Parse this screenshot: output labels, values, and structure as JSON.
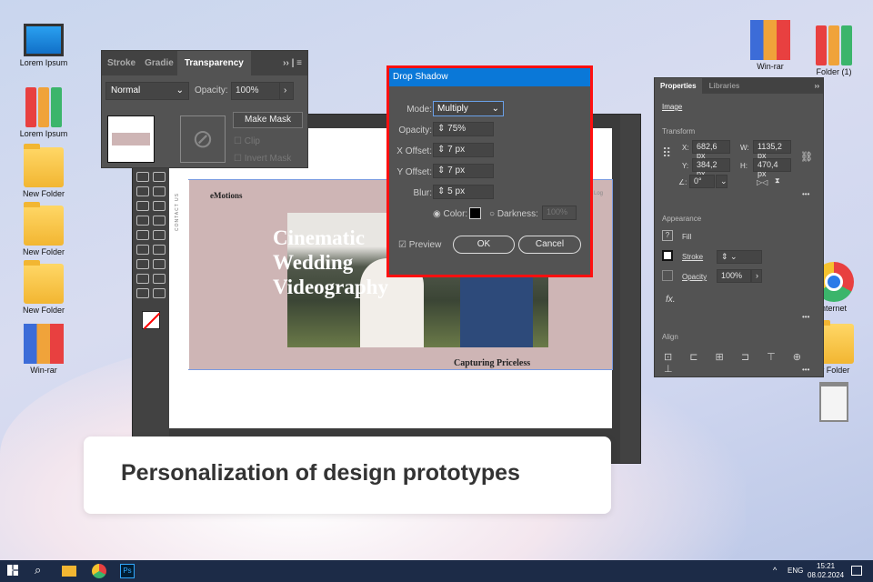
{
  "desktop": {
    "left_icons": [
      {
        "label": "Lorem Ipsum",
        "icon": "monitor-icon"
      },
      {
        "label": "Lorem Ipsum",
        "icon": "binders-icon"
      },
      {
        "label": "New Folder",
        "icon": "folder-icon"
      },
      {
        "label": "New Folder",
        "icon": "folder-icon"
      },
      {
        "label": "New Folder",
        "icon": "folder-icon"
      },
      {
        "label": "Win-rar",
        "icon": "winrar-icon"
      }
    ],
    "right_icons": [
      {
        "label": "Win-rar",
        "icon": "winrar-icon"
      },
      {
        "label": "Folder (1)",
        "icon": "binders-icon"
      },
      {
        "label": "nternet",
        "icon": "chrome-icon"
      },
      {
        "label": "w Folder",
        "icon": "folder-icon"
      },
      {
        "label": "",
        "icon": "recycle-bin-icon"
      }
    ]
  },
  "transparency": {
    "tabs": [
      "Stroke",
      "Gradie",
      "Transparency"
    ],
    "blend_mode": "Normal",
    "opacity_label": "Opacity:",
    "opacity": "100%",
    "make_mask": "Make Mask",
    "clip": "Clip",
    "invert_mask": "Invert Mask"
  },
  "drop_shadow": {
    "title": "Drop Shadow",
    "mode_label": "Mode:",
    "mode": "Multiply",
    "opacity_label": "Opacity:",
    "opacity": "75%",
    "x_label": "X Offset:",
    "x": "7 px",
    "y_label": "Y Offset:",
    "y": "7 px",
    "blur_label": "Blur:",
    "blur": "5 px",
    "color_label": "Color:",
    "darkness_label": "Darkness:",
    "darkness": "100%",
    "preview": "Preview",
    "ok": "OK",
    "cancel": "Cancel",
    "color": "#000000"
  },
  "artboard": {
    "brand": "eMotions",
    "side_text": "CONTACT US",
    "headline": [
      "Cinematic",
      "Wedding",
      "Videography"
    ],
    "subhead": "Capturing Priceless",
    "login": "Log"
  },
  "properties": {
    "tabs": [
      "Properties",
      "Libraries"
    ],
    "object": "Image",
    "transform": "Transform",
    "x_label": "X:",
    "x": "682,6 px",
    "y_label": "Y:",
    "y": "384,2 px",
    "w_label": "W:",
    "w": "1135,2 px",
    "h_label": "H:",
    "h": "470,4 px",
    "angle": "0°",
    "appearance": "Appearance",
    "fill": "Fill",
    "stroke": "Stroke",
    "opacity_label": "Opacity",
    "opacity": "100%",
    "fx": "fx.",
    "align": "Align"
  },
  "caption": "Personalization of design prototypes",
  "taskbar": {
    "lang": "ENG",
    "time": "15:21",
    "date": "08.02.2024"
  }
}
